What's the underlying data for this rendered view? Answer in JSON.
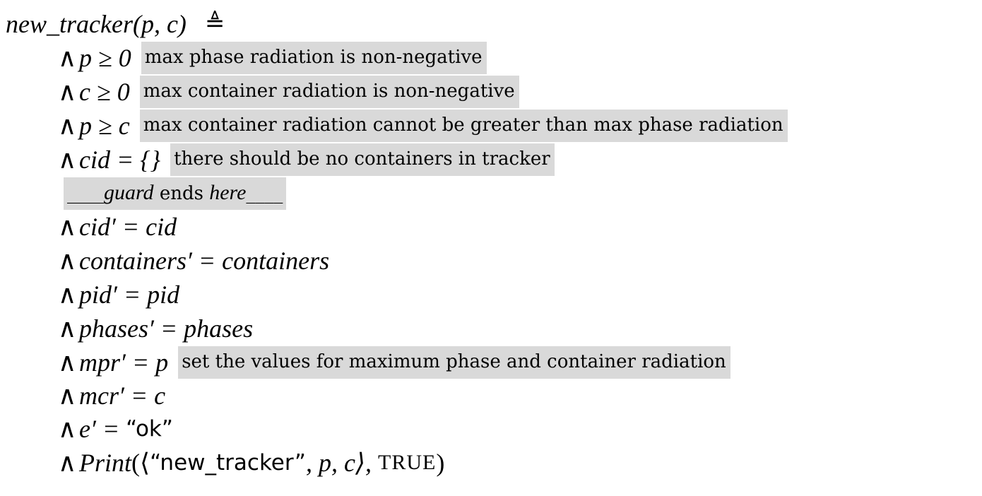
{
  "header": {
    "name": "new_tracker",
    "params": "(p, c)",
    "defeq": "≜"
  },
  "conjunct_symbol": "∧",
  "preconditions": [
    {
      "expr": "p ≥ 0",
      "comment": "max phase radiation is non-negative"
    },
    {
      "expr": "c ≥ 0",
      "comment": "max container radiation is non-negative"
    },
    {
      "expr": "p ≥ c",
      "comment": "max container radiation cannot be greater than max phase radiation"
    },
    {
      "expr": "cid = {}",
      "comment": "there should be no containers in tracker"
    }
  ],
  "guard_marker": {
    "prefix": "____",
    "guard_word": "guard",
    "middle": " ends ",
    "here_word": "here",
    "suffix": "____"
  },
  "actions": [
    {
      "expr": "cid′ = cid"
    },
    {
      "expr": "containers′ = containers"
    },
    {
      "expr": "pid′ = pid"
    },
    {
      "expr": "phases′ = phases"
    },
    {
      "expr": "mpr′ = p",
      "comment": "set the values for maximum phase and container radiation"
    },
    {
      "expr": "mcr′ = c"
    }
  ],
  "e_line": {
    "lhs": "e′ = ",
    "value": "“ok”"
  },
  "print_line": {
    "fn": "Print",
    "open": "(⟨",
    "label": "“new_tracker”",
    "args": ", p, c⟩, ",
    "flag": "TRUE",
    "close": ")"
  }
}
